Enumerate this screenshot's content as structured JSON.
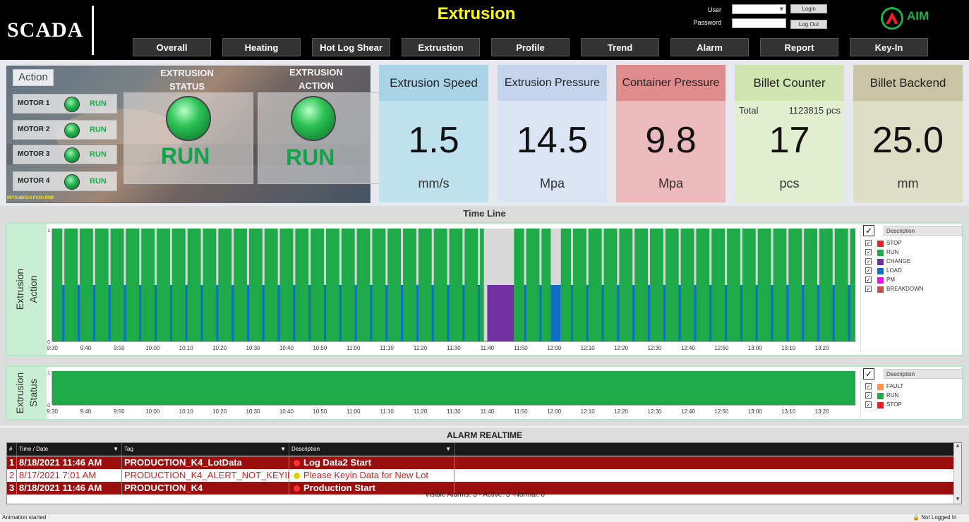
{
  "header": {
    "logo": "SCADA",
    "title": "Extrusion",
    "user_label": "User",
    "password_label": "Password",
    "login_button": "Login",
    "logout_button": "Log Out",
    "brand": "AIM",
    "nav": [
      "Overall",
      "Heating",
      "Hot Log Shear",
      "Extrustion",
      "Profile",
      "Trend",
      "Alarm",
      "Report",
      "Key-In"
    ]
  },
  "action_panel": {
    "label": "Action",
    "motors": [
      {
        "name": "MOTOR 1",
        "status": "RUN"
      },
      {
        "name": "MOTOR 2",
        "status": "RUN"
      },
      {
        "name": "MOTOR 3",
        "status": "RUN"
      },
      {
        "name": "MOTOR 4",
        "status": "RUN"
      }
    ],
    "extrusion_status_title": "EXTRUSION\nSTATUS",
    "extrusion_status_line1": "EXTRUSION",
    "extrusion_status_line2": "STATUS",
    "extrusion_status_value": "RUN",
    "extrusion_action_line1": "EXTRUSION",
    "extrusion_action_line2": "ACTION",
    "extrusion_action_value": "RUN",
    "plc_label": "MITSUBICHI FX3U IP39"
  },
  "metrics": [
    {
      "title": "Extrusion Speed",
      "value": "1.5",
      "unit": "mm/s",
      "head_color": "#a9d3e6",
      "body_color": "#bfe1ee"
    },
    {
      "title": "Extrusion Pressure",
      "value": "14.5",
      "unit": "Mpa",
      "head_color": "#c4d4ec",
      "body_color": "#dae4f4"
    },
    {
      "title": "Container Pressure",
      "value": "9.8",
      "unit": "Mpa",
      "head_color": "#e08c8c",
      "body_color": "#ecbaba"
    },
    {
      "title": "Billet Counter",
      "value": "17",
      "unit": "pcs",
      "head_color": "#cfe4b0",
      "body_color": "#e2eed0",
      "total_label": "Total",
      "total_value": "1123815 pcs"
    },
    {
      "title": "Billet Backend",
      "value": "25.0",
      "unit": "mm",
      "head_color": "#c8c4a4",
      "body_color": "#deddc6"
    }
  ],
  "timeline": {
    "title": "Time Line",
    "legend_header": "Description"
  },
  "chart_data": [
    {
      "type": "area",
      "title": "",
      "ylabel": "Extrusion Action",
      "x_ticks": [
        "9:30",
        "9:40",
        "9:50",
        "10:00",
        "10:10",
        "10:20",
        "10:30",
        "10:40",
        "10:50",
        "11:00",
        "11:10",
        "11:20",
        "11:30",
        "11:40",
        "11:50",
        "12:00",
        "12:10",
        "12:20",
        "12:30",
        "12:40",
        "12:50",
        "13:00",
        "13:10",
        "13:20"
      ],
      "ylim": [
        0,
        1
      ],
      "y_ticks": [
        "0",
        "1"
      ],
      "legend": [
        {
          "name": "STOP",
          "color": "#ee1c24"
        },
        {
          "name": "RUN",
          "color": "#1faa4a"
        },
        {
          "name": "CHANGE",
          "color": "#7030a0"
        },
        {
          "name": "LOAD",
          "color": "#0f6fc6"
        },
        {
          "name": "PM",
          "color": "#ff00ff"
        },
        {
          "name": "BREAKDOWN",
          "color": "#c0504d"
        }
      ],
      "series_note": "RUN (green, full height) dominant with periodic short LOAD (blue, half height) gaps; CHANGE (purple, half height) near 11:40; LOAD near 12:00",
      "segments": [
        {
          "state": "RUN",
          "start": "9:30",
          "end": "11:39"
        },
        {
          "state": "CHANGE",
          "start": "11:40",
          "end": "11:48"
        },
        {
          "state": "RUN",
          "start": "11:48",
          "end": "11:59"
        },
        {
          "state": "LOAD",
          "start": "11:59",
          "end": "12:02"
        },
        {
          "state": "RUN",
          "start": "12:02",
          "end": "13:30"
        }
      ]
    },
    {
      "type": "area",
      "title": "",
      "ylabel": "Extrusion Status",
      "x_ticks": [
        "9:30",
        "9:40",
        "9:50",
        "10:00",
        "10:10",
        "10:20",
        "10:30",
        "10:40",
        "10:50",
        "11:00",
        "11:10",
        "11:20",
        "11:30",
        "11:40",
        "11:50",
        "12:00",
        "12:10",
        "12:20",
        "12:30",
        "12:40",
        "12:50",
        "13:00",
        "13:10",
        "13:20"
      ],
      "ylim": [
        0,
        1
      ],
      "y_ticks": [
        "0",
        "1"
      ],
      "legend": [
        {
          "name": "FAULT",
          "color": "#f79646"
        },
        {
          "name": "RUN",
          "color": "#1faa4a"
        },
        {
          "name": "STOP",
          "color": "#ee1c24"
        }
      ],
      "segments": [
        {
          "state": "RUN",
          "start": "9:30",
          "end": "13:30"
        }
      ]
    }
  ],
  "alarm": {
    "title": "ALARM REALTIME",
    "columns": [
      "#",
      "Time / Date",
      "Tag",
      "Description"
    ],
    "rows": [
      {
        "num": "1",
        "time": "8/18/2021 11:46 AM",
        "tag": "PRODUCTION_K4_LotData",
        "desc": "Log Data2 Start",
        "style": "active",
        "dot": "#ff3030"
      },
      {
        "num": "2",
        "time": "8/17/2021 7:01 AM",
        "tag": "PRODUCTION_K4_ALERT_NOT_KEYIN",
        "desc": "Please Keyin Data for  New Lot",
        "style": "selected",
        "dot": "#e0d000"
      },
      {
        "num": "3",
        "time": "8/18/2021 11:46 AM",
        "tag": "PRODUCTION_K4",
        "desc": "Production Start",
        "style": "active",
        "dot": "#ff3030"
      }
    ],
    "summary": "Visible Alarms: 3 - Active: 3 -Normal: 0"
  },
  "statusbar": {
    "left": "Animation started",
    "right": "Not Logged In"
  }
}
